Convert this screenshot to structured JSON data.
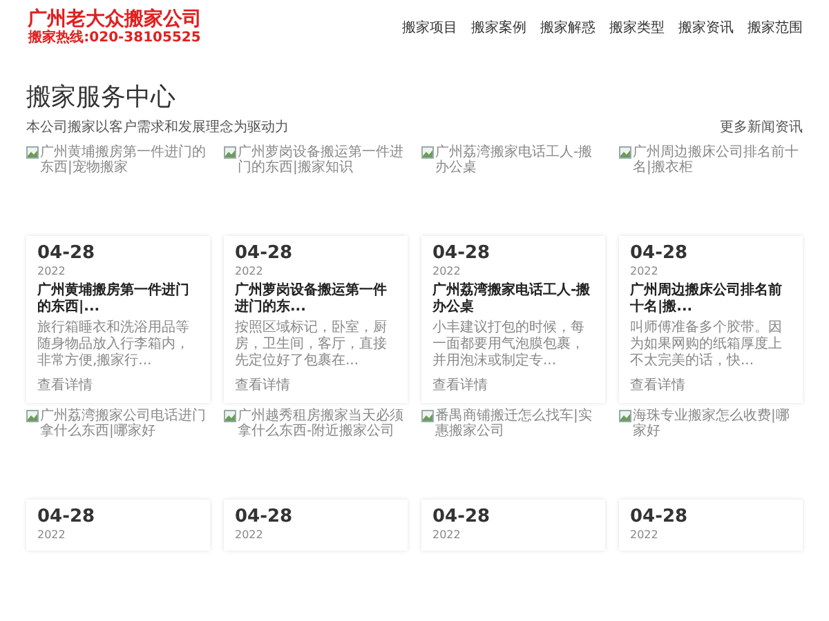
{
  "logo": {
    "name": "广州老大众搬家公司",
    "hotline": "搬家热线:020-38105525"
  },
  "nav": [
    "搬家项目",
    "搬家案例",
    "搬家解惑",
    "搬家类型",
    "搬家资讯",
    "搬家范围"
  ],
  "section": {
    "title": "搬家服务中心",
    "subtitle": "本公司搬家以客户需求和发展理念为驱动力",
    "more_link": "更多新闻资讯"
  },
  "articles": [
    {
      "image_alt": "广州黄埔搬房第一件进门的东西|宠物搬家",
      "date": "04-28",
      "year": "2022",
      "title": "广州黄埔搬房第一件进门的东西|...",
      "excerpt": "旅行箱睡衣和洗浴用品等随身物品放入行李箱内，非常方便,搬家行...",
      "link": "查看详情"
    },
    {
      "image_alt": "广州萝岗设备搬运第一件进门的东西|搬家知识",
      "date": "04-28",
      "year": "2022",
      "title": "广州萝岗设备搬运第一件进门的东...",
      "excerpt": "按照区域标记，卧室，厨房，卫生间，客厅，直接先定位好了包裹在...",
      "link": "查看详情"
    },
    {
      "image_alt": "广州荔湾搬家电话工人-搬办公桌",
      "date": "04-28",
      "year": "2022",
      "title": "广州荔湾搬家电话工人-搬办公桌",
      "excerpt": "小丰建议打包的时候，每一面都要用气泡膜包裹，并用泡沫或制定专...",
      "link": "查看详情"
    },
    {
      "image_alt": "广州周边搬床公司排名前十名|搬衣柜",
      "date": "04-28",
      "year": "2022",
      "title": "广州周边搬床公司排名前十名|搬...",
      "excerpt": "叫师傅准备多个胶带。因为如果网购的纸箱厚度上不太完美的话，快...",
      "link": "查看详情"
    },
    {
      "image_alt": "广州荔湾搬家公司电话进门拿什么东西|哪家好",
      "date": "04-28",
      "year": "2022"
    },
    {
      "image_alt": "广州越秀租房搬家当天必须拿什么东西-附近搬家公司",
      "date": "04-28",
      "year": "2022"
    },
    {
      "image_alt": "番禺商铺搬迁怎么找车|实惠搬家公司",
      "date": "04-28",
      "year": "2022"
    },
    {
      "image_alt": "海珠专业搬家怎么收费|哪家好",
      "date": "04-28",
      "year": "2022"
    }
  ]
}
